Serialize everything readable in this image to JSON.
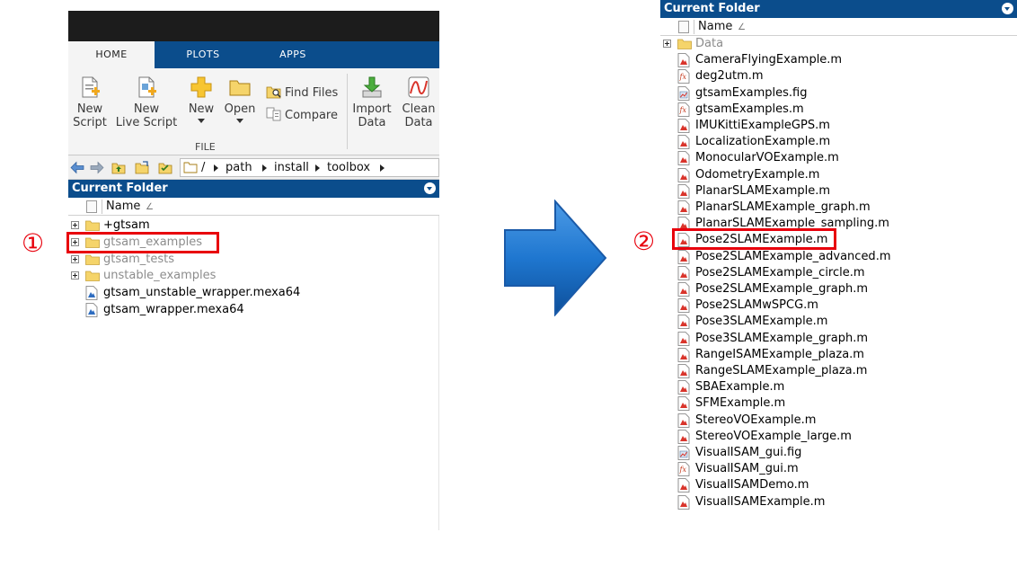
{
  "left": {
    "tabs": [
      "HOME",
      "PLOTS",
      "APPS"
    ],
    "ribbon": {
      "new_script": [
        "New",
        "Script"
      ],
      "new_live_script": [
        "New",
        "Live Script"
      ],
      "new": "New",
      "open": "Open",
      "find_files": "Find Files",
      "compare": "Compare",
      "section_file": "FILE",
      "import_data": [
        "Import",
        "Data"
      ],
      "clean_data": [
        "Clean",
        "Data"
      ]
    },
    "path": {
      "root": "/",
      "crumbs": [
        "path",
        "install",
        "toolbox"
      ]
    },
    "current_folder_title": "Current Folder",
    "column_name": "Name",
    "sort_indicator": "∠",
    "items": [
      {
        "name": "+gtsam",
        "type": "folder",
        "expandable": true,
        "dim": false
      },
      {
        "name": "gtsam_examples",
        "type": "folder",
        "expandable": true,
        "dim": true
      },
      {
        "name": "gtsam_tests",
        "type": "folder",
        "expandable": true,
        "dim": true
      },
      {
        "name": "unstable_examples",
        "type": "folder",
        "expandable": true,
        "dim": true
      },
      {
        "name": "gtsam_unstable_wrapper.mexa64",
        "type": "mex",
        "expandable": false,
        "dim": false
      },
      {
        "name": "gtsam_wrapper.mexa64",
        "type": "mex",
        "expandable": false,
        "dim": false
      }
    ],
    "callout": "①"
  },
  "right": {
    "current_folder_title": "Current Folder",
    "column_name": "Name",
    "sort_indicator": "∠",
    "items": [
      {
        "name": "Data",
        "type": "folder",
        "expandable": true,
        "dim": true
      },
      {
        "name": "CameraFlyingExample.m",
        "type": "m"
      },
      {
        "name": "deg2utm.m",
        "type": "mfunc"
      },
      {
        "name": "gtsamExamples.fig",
        "type": "fig"
      },
      {
        "name": "gtsamExamples.m",
        "type": "mfunc"
      },
      {
        "name": "IMUKittiExampleGPS.m",
        "type": "m"
      },
      {
        "name": "LocalizationExample.m",
        "type": "m"
      },
      {
        "name": "MonocularVOExample.m",
        "type": "m"
      },
      {
        "name": "OdometryExample.m",
        "type": "m"
      },
      {
        "name": "PlanarSLAMExample.m",
        "type": "m"
      },
      {
        "name": "PlanarSLAMExample_graph.m",
        "type": "m"
      },
      {
        "name": "PlanarSLAMExample_sampling.m",
        "type": "m"
      },
      {
        "name": "Pose2SLAMExample.m",
        "type": "m"
      },
      {
        "name": "Pose2SLAMExample_advanced.m",
        "type": "m"
      },
      {
        "name": "Pose2SLAMExample_circle.m",
        "type": "m"
      },
      {
        "name": "Pose2SLAMExample_graph.m",
        "type": "m"
      },
      {
        "name": "Pose2SLAMwSPCG.m",
        "type": "m"
      },
      {
        "name": "Pose3SLAMExample.m",
        "type": "m"
      },
      {
        "name": "Pose3SLAMExample_graph.m",
        "type": "m"
      },
      {
        "name": "RangeISAMExample_plaza.m",
        "type": "m"
      },
      {
        "name": "RangeSLAMExample_plaza.m",
        "type": "m"
      },
      {
        "name": "SBAExample.m",
        "type": "m"
      },
      {
        "name": "SFMExample.m",
        "type": "m"
      },
      {
        "name": "StereoVOExample.m",
        "type": "m"
      },
      {
        "name": "StereoVOExample_large.m",
        "type": "m"
      },
      {
        "name": "VisualISAM_gui.fig",
        "type": "fig"
      },
      {
        "name": "VisualISAM_gui.m",
        "type": "mfunc"
      },
      {
        "name": "VisualISAMDemo.m",
        "type": "m"
      },
      {
        "name": "VisualISAMExample.m",
        "type": "m"
      }
    ],
    "callout": "②"
  },
  "colors": {
    "matlab_blue": "#0b4d8c",
    "highlight_red": "#e8000c",
    "arrow_blue": "#1f77d0",
    "folder_yellow": "#f5d46a"
  }
}
